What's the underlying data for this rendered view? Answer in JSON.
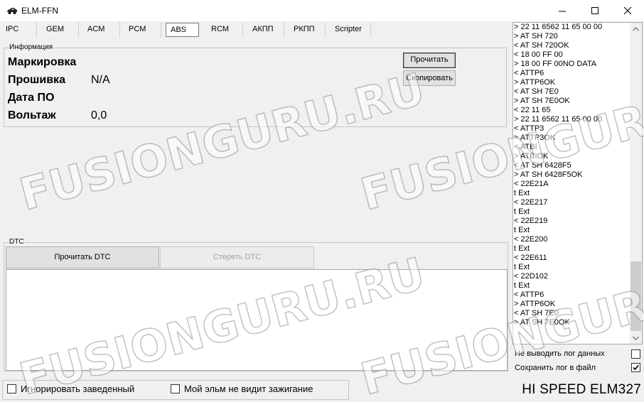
{
  "window": {
    "title": "ELM-FFN"
  },
  "tabs": [
    {
      "label": "IPC"
    },
    {
      "label": "GEM"
    },
    {
      "label": "ACM"
    },
    {
      "label": "PCM"
    },
    {
      "label": "ABS"
    },
    {
      "label": "RCM"
    },
    {
      "label": "АКПП"
    },
    {
      "label": "РКПП"
    },
    {
      "label": "Scripter"
    }
  ],
  "active_tab": "ABS",
  "info": {
    "group_title": "Информация",
    "rows": [
      {
        "label": "Маркировка",
        "value": ""
      },
      {
        "label": "Прошивка",
        "value": "N/A"
      },
      {
        "label": "Дата ПО",
        "value": ""
      },
      {
        "label": "Вольтаж",
        "value": "0,0"
      }
    ],
    "read_button": "Прочитать",
    "copy_button": "Скопировать"
  },
  "dtc": {
    "group_title": "DTC",
    "read_button": "Прочитать DTC",
    "clear_button": "Стереть DTC"
  },
  "log": {
    "lines": [
      "> 22 11 6562 11 65 00 00",
      "> AT SH 720",
      "< AT SH 720OK",
      "< 18 00 FF 00",
      "> 18 00 FF 00NO DATA",
      "< ATTP6",
      "> ATTP6OK",
      "< AT SH 7E0",
      "> AT SH 7E0OK",
      "< 22 11 65",
      "> 22 11 6562 11 65 00 00",
      "< ATTP3",
      "> ATTP3OK",
      "< ATBI",
      "> ATBIOK",
      "< AT SH 6428F5",
      "> AT SH 6428F5OK",
      "< 22E21A",
      "t Ext",
      "< 22E217",
      "t Ext",
      "< 22E219",
      "t Ext",
      "< 22E200",
      "t Ext",
      "< 22E611",
      "t Ext",
      "< 22D102",
      "t Ext",
      "< ATTP6",
      "> ATTP6OK",
      "< AT SH 7E0",
      "> AT SH 7E0OK"
    ],
    "scroll_position": 0.78
  },
  "options": {
    "no_log_data": {
      "label": "Не выводить лог данных",
      "checked": false
    },
    "save_log": {
      "label": "Сохранить лог в файл",
      "checked": true
    }
  },
  "bottom": {
    "ignore_running": {
      "label": "Игнорировать заведенный",
      "checked": false
    },
    "no_ignition": {
      "label": "Мой эльм не видит зажигание",
      "checked": false
    },
    "status": "HI SPEED ELM327"
  },
  "watermark": "FUSIONGURU.RU"
}
